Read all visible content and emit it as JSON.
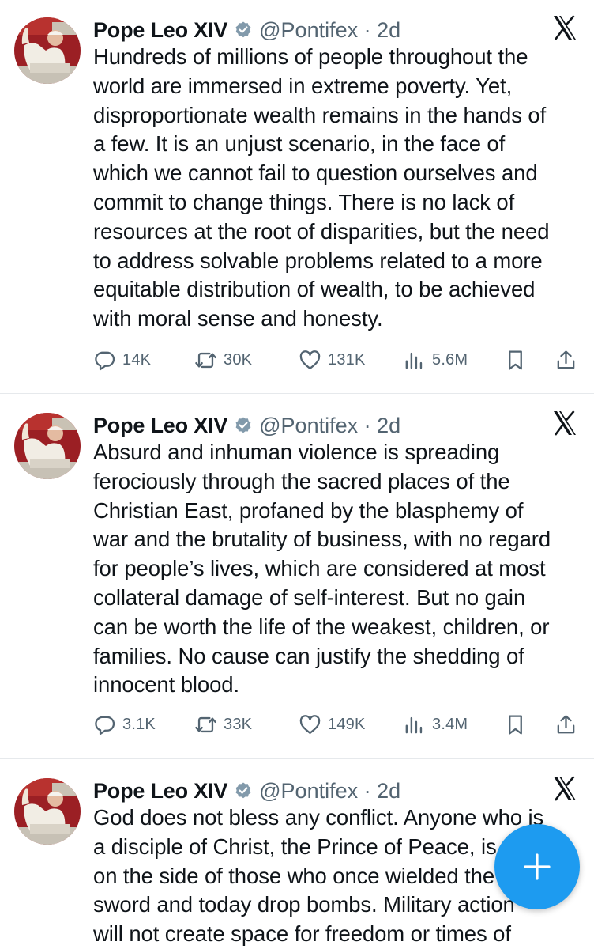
{
  "tweets": [
    {
      "author": "Pope Leo XIV",
      "handle": "@Pontifex · 2d",
      "text": "Hundreds of millions of people throughout the\nworld are immersed in extreme poverty. Yet,\ndisproportionate wealth remains in the hands of\na few. It is an unjust scenario, in the face of\nwhich we cannot fail to question ourselves and\ncommit to change things. There is no lack of\nresources at the root of disparities, but the need\nto address solvable problems related to a more\nequitable distribution of wealth, to be achieved\nwith moral sense and honesty.",
      "replies": "14K",
      "reposts": "30K",
      "likes": "131K",
      "views": "5.6M"
    },
    {
      "author": "Pope Leo XIV",
      "handle": "@Pontifex · 2d",
      "text": "Absurd and inhuman violence is spreading\nferociously through the sacred places of the\nChristian East, profaned by the blasphemy of\nwar and the brutality of business, with no regard\nfor people’s lives, which are considered at most\ncollateral damage of self-interest. But no gain\ncan be worth the life of the weakest, children, or\nfamilies. No cause can justify the shedding of\ninnocent blood.",
      "replies": "3.1K",
      "reposts": "33K",
      "likes": "149K",
      "views": "3.4M"
    },
    {
      "author": "Pope Leo XIV",
      "handle": "@Pontifex · 2d",
      "text": "God does not bless any conflict. Anyone who is\na disciple of Christ, the Prince of Peace, is never\non the side of those who once wielded the\nsword and today drop bombs. Military action\nwill not create space for freedom or times of"
    }
  ],
  "icons": {
    "verified": "verified-badge-icon",
    "platform": "x-logo-icon",
    "reply": "reply-icon",
    "repost": "repost-icon",
    "like": "heart-icon",
    "views": "views-icon",
    "bookmark": "bookmark-icon",
    "share": "share-icon",
    "compose": "plus-icon"
  },
  "colors": {
    "text": "#0f1419",
    "muted": "#536471",
    "accent": "#1d9bf0",
    "divider": "#e6e9ec"
  }
}
